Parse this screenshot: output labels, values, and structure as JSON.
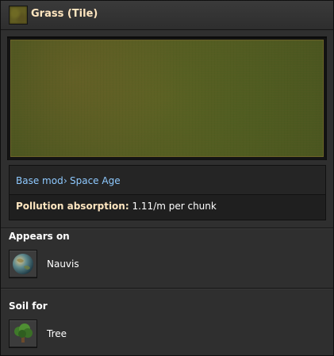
{
  "title": "Grass (Tile)",
  "breadcrumb": {
    "mod": "Base mod",
    "separator": "›",
    "expansion": "Space Age"
  },
  "pollution": {
    "label": "Pollution absorption:",
    "value": "1.11/m per chunk"
  },
  "appears_on": {
    "heading": "Appears on",
    "items": [
      {
        "label": "Nauvis",
        "icon": "nauvis-planet-icon"
      }
    ]
  },
  "soil_for": {
    "heading": "Soil for",
    "items": [
      {
        "label": "Tree",
        "icon": "tree-icon"
      }
    ]
  },
  "colors": {
    "title": "#ffe6c0",
    "link": "#8ec9ff",
    "panel": "#2f2f2f"
  }
}
